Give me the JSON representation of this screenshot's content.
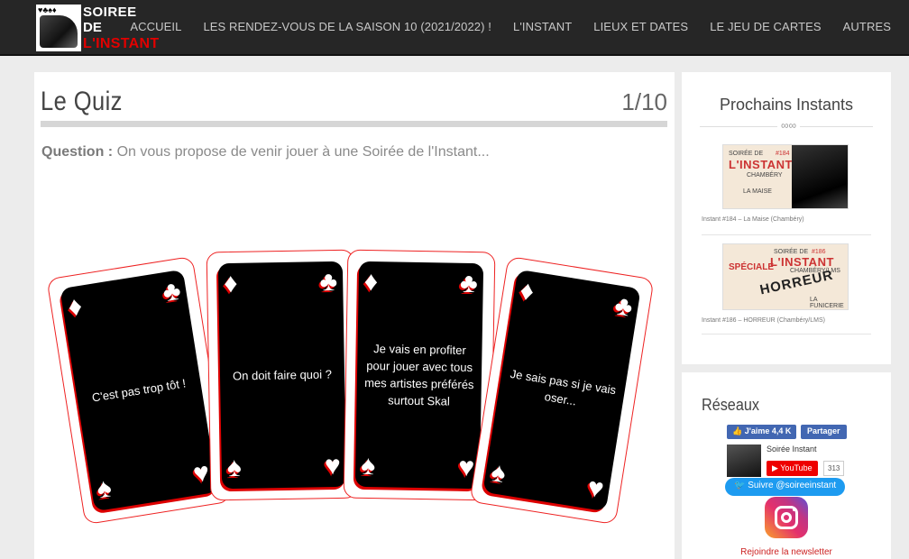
{
  "header": {
    "logo": {
      "line1": "SOIREE",
      "line2": "DE",
      "line3": "L'INSTANT",
      "suits": "♥♣♠♦"
    },
    "nav": [
      "ACCUEIL",
      "LES RENDEZ-VOUS DE LA SAISON 10 (2021/2022) !",
      "L'INSTANT",
      "LIEUX ET DATES",
      "LE JEU DE CARTES",
      "AUTRES"
    ]
  },
  "quiz": {
    "title": "Le Quiz",
    "progress": "1/10",
    "progress_fraction": 0.1,
    "question_label": "Question :",
    "question_text": "On vous propose de venir jouer à une Soirée de l'Instant...",
    "answers": [
      "C'est pas trop tôt !",
      "On doit faire quoi ?",
      "Je vais en profiter pour jouer avec tous mes artistes préférés surtout Skal",
      "Je sais pas si je vais oser..."
    ]
  },
  "sidebar": {
    "upcoming_title": "Prochains Instants",
    "events": [
      {
        "caption": "Instant #184 – La Maise (Chambéry)",
        "small": "SOIRÉE DE",
        "big": "L'INSTANT",
        "place": "CHAMBÉRY",
        "num": "#184",
        "venue": "LA MAISE"
      },
      {
        "caption": "Instant #186 – HORREUR (Chambéry/LMS)",
        "small": "SOIRÉE DE",
        "big": "L'INSTANT",
        "place": "CHAMBÉRY/LMS",
        "num": "#186",
        "theme": "HORREUR",
        "ribbon": "SPÉCIALE",
        "venue": "LA FUNICERIE"
      }
    ],
    "networks_title": "Réseaux",
    "fb_like": "👍 J'aime 4,4 K",
    "fb_share": "Partager",
    "yt_channel": "Soirée Instant",
    "yt_button": "▶ YouTube",
    "yt_count": "313",
    "twitter": "🐦 Suivre @soireeinstant",
    "newsletter": "Rejoindre la newsletter"
  }
}
